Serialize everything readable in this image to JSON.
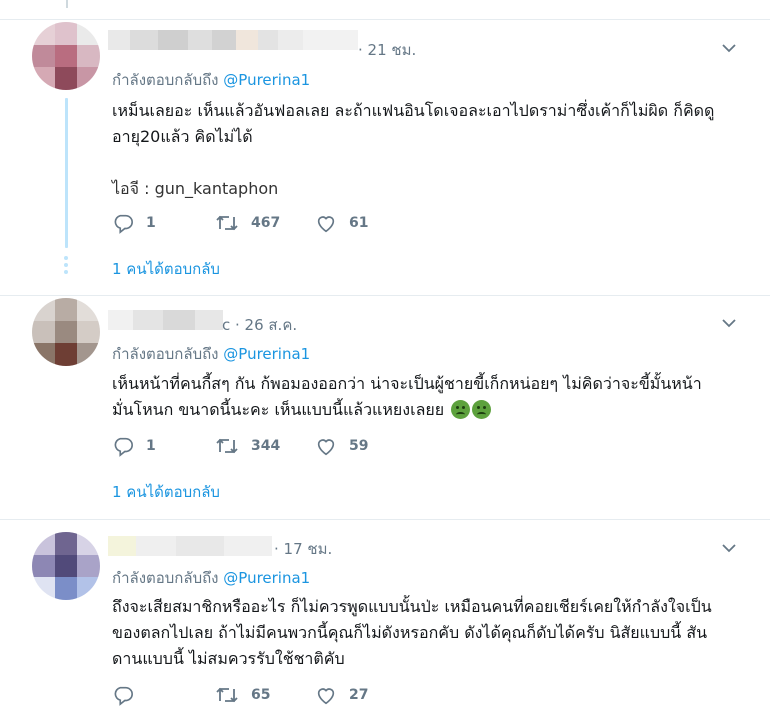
{
  "tweets": [
    {
      "time": "· 21 ชม.",
      "replying_prefix": "กำลังตอบกลับถึง",
      "replying_handle": "@Purerina1",
      "body_lines": [
        "เหม็นเลยอะ เห็นแล้วอันฟอลเลย ละถ้าแฟนอินโดเจอละเอาไปดราม่าซึ่งเค้าก็ไม่ผิด ก็คิดดู",
        "อายุ20แล้ว คิดไม่ได้",
        "",
        "ไอจี : gun_kantaphon"
      ],
      "replies": "1",
      "retweets": "467",
      "likes": "61",
      "show_replies": "1 คนได้ตอบกลับ",
      "avatar_colors": [
        "#e6d0d6",
        "#dfc2cc",
        "#eaeaea",
        "#c08a9a",
        "#b96d80",
        "#d8b8c2",
        "#d5a9b4",
        "#8e4a5b",
        "#c896a5"
      ]
    },
    {
      "time": "c · 26 ส.ค.",
      "replying_prefix": "กำลังตอบกลับถึง",
      "replying_handle": "@Purerina1",
      "body_lines": [
        "เห็นหน้าที่คนกี้สๆ กัน ก้พอมองออกว่า น่าจะเป็นผู้ชายขี้เก็กหน่อยๆ ไม่คิดว่าจะขี้มั้นหน้า",
        "มั่นโหนก ขนาดนี้นะคะ เห็นแบบนี้แล้วแหยงเลยย"
      ],
      "emoji": [
        "nauseated-face",
        "nauseated-face"
      ],
      "replies": "1",
      "retweets": "344",
      "likes": "59",
      "show_replies": "1 คนได้ตอบกลับ",
      "avatar_colors": [
        "#d9d3cf",
        "#b8aca4",
        "#e2ddd9",
        "#c9c0ba",
        "#9a8a80",
        "#d4ccc6",
        "#8a7568",
        "#6e3e34",
        "#a3968e"
      ]
    },
    {
      "time": "· 17 ชม.",
      "replying_prefix": "กำลังตอบกลับถึง",
      "replying_handle": "@Purerina1",
      "body_lines": [
        "ถึงจะเสียสมาชิกหรืออะไร ก็ไม่ควรพูดแบบนั้นป่ะ เหมือนคนที่คอยเชียร์เคยให้กำลังใจเป็น",
        "ของตลกไปเลย ถ้าไม่มีคนพวกนี้คุณก็ไม่ดังหรอกคับ ดังได้คุณก็ดับได้ครับ นิสัยแบบนี้ สัน",
        "ดานแบบนี้ ไม่สมควรรับใช้ชาติคับ"
      ],
      "replies": "",
      "retweets": "65",
      "likes": "27",
      "avatar_colors": [
        "#c9c3dc",
        "#6f6590",
        "#d7d3e6",
        "#8d87b4",
        "#514a7a",
        "#a9a3c8",
        "#dfe3f2",
        "#7b8ec8",
        "#b2c2e8"
      ]
    }
  ],
  "colors": {
    "accent": "#1b95e0",
    "muted": "#657786",
    "thread": "#bde4fb",
    "divider": "#e6ecf0"
  },
  "icons": [
    "reply-icon",
    "retweet-icon",
    "like-icon",
    "chevron-down-icon"
  ]
}
